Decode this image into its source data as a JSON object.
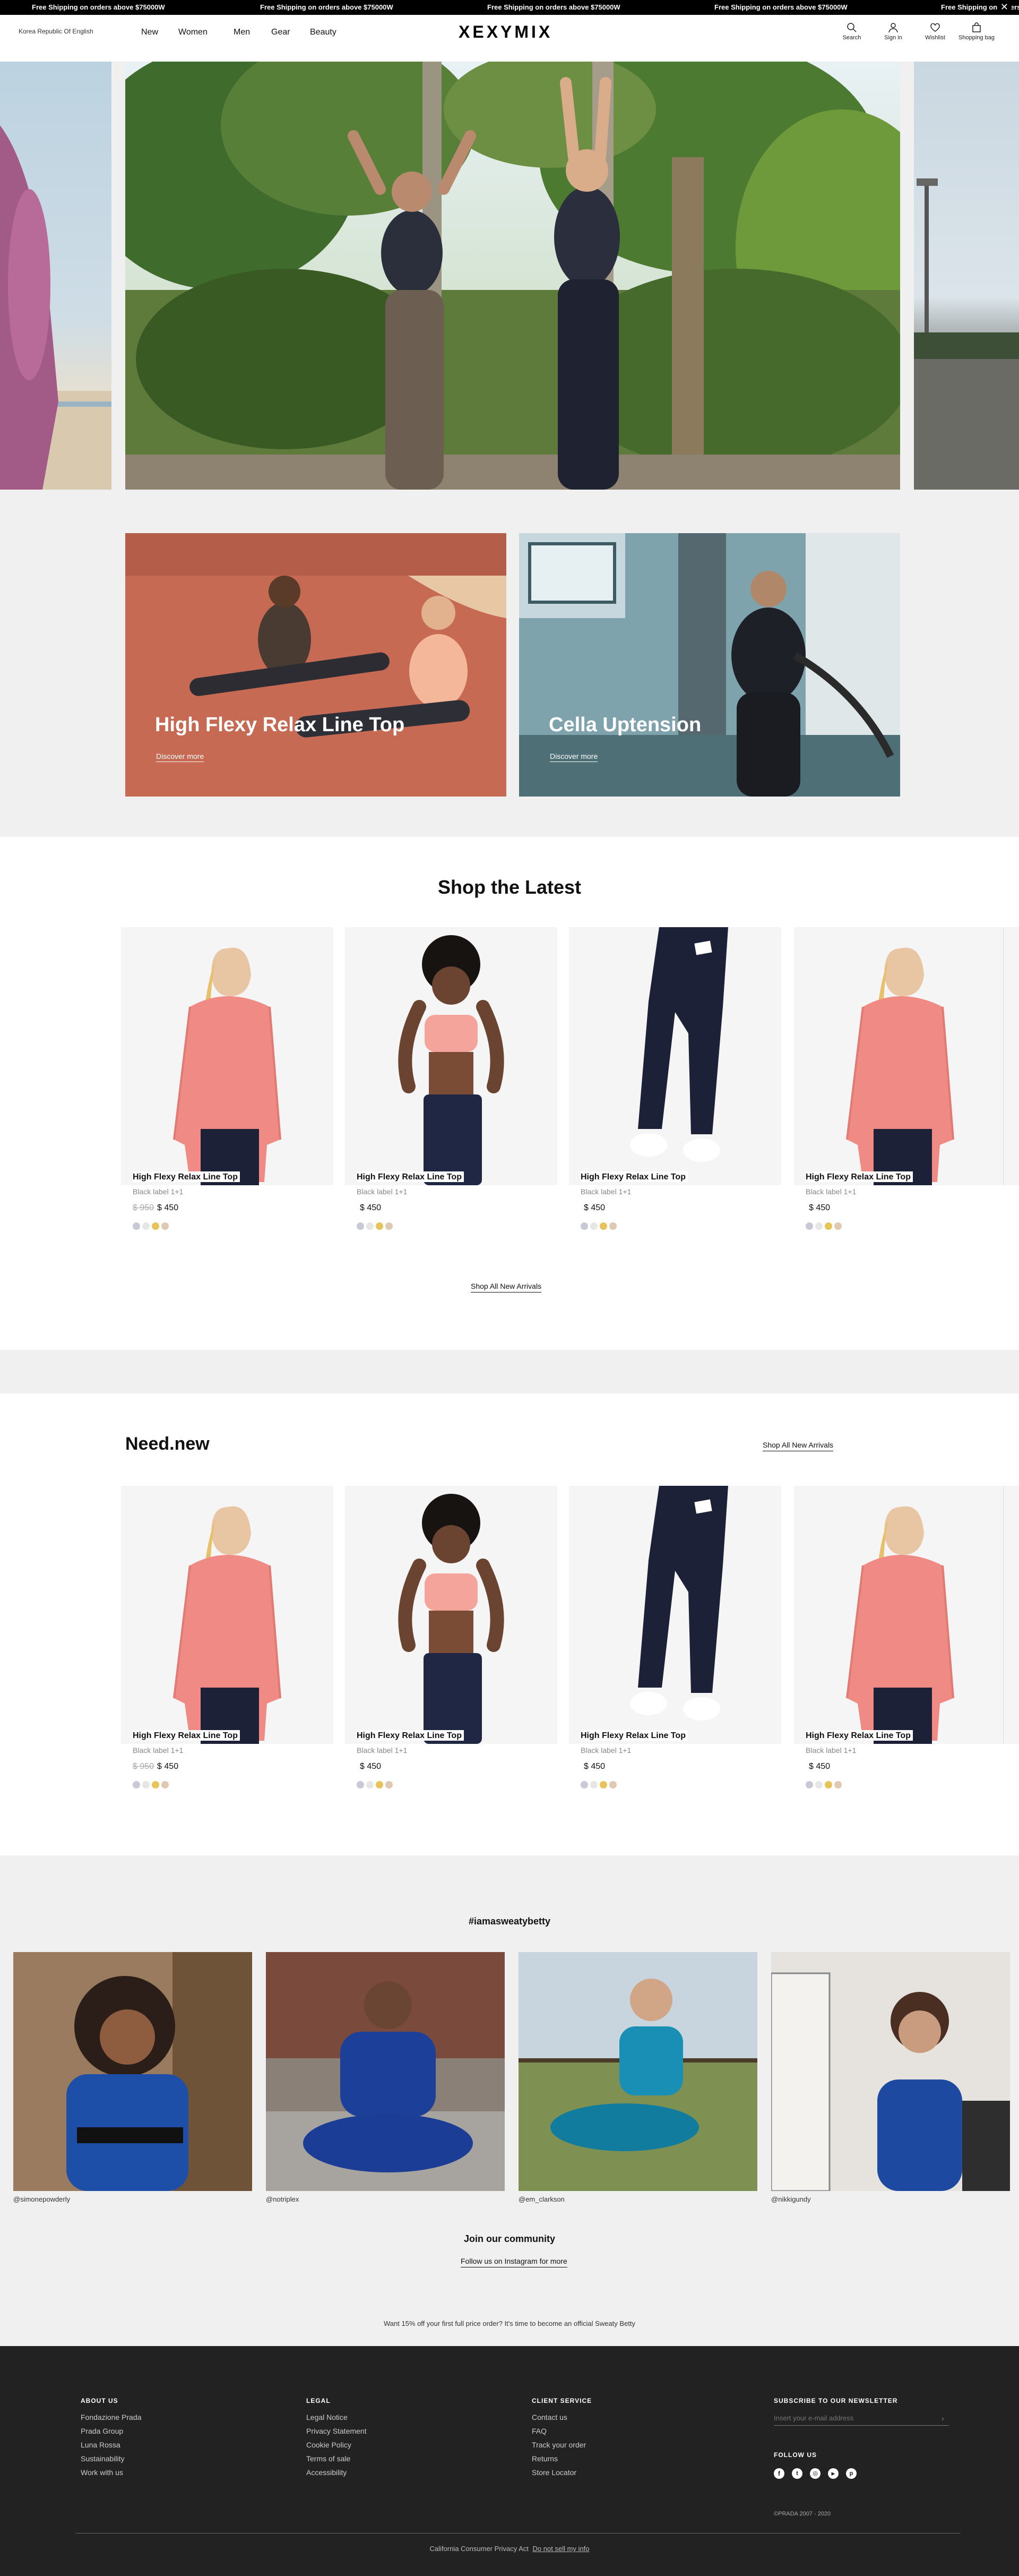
{
  "ticker": {
    "message": "Free Shipping on orders above $75000W",
    "close_label": "✕"
  },
  "header": {
    "locale": "Korea Republic Of  English",
    "nav": [
      "New",
      "Women",
      "Men",
      "Gear",
      "Beauty"
    ],
    "logo": "XEXYMIX",
    "utils": {
      "search": "Search",
      "signin": "Sign in",
      "wishlist": "Wishlist",
      "bag": "Shopping bag"
    }
  },
  "tiles": [
    {
      "title": "High Flexy Relax Line Top",
      "cta": "Discover more"
    },
    {
      "title": "Cella Uptension",
      "cta": "Discover more"
    }
  ],
  "latest": {
    "title": "Shop the Latest",
    "cta": "Shop All New Arrivals",
    "products": [
      {
        "name": "High Flexy Relax Line Top",
        "label": "Black label 1+1",
        "old_price": "$ 950",
        "price": "$ 450"
      },
      {
        "name": "High Flexy Relax Line Top",
        "label": "Black label 1+1",
        "old_price": "",
        "price": "$ 450"
      },
      {
        "name": "High Flexy Relax Line Top",
        "label": "Black label 1+1",
        "old_price": "",
        "price": "$ 450"
      },
      {
        "name": "High Flexy Relax Line Top",
        "label": "Black label 1+1",
        "old_price": "",
        "price": "$ 450"
      }
    ]
  },
  "need": {
    "title": "Need.new",
    "cta": "Shop All New Arrivals",
    "products": [
      {
        "name": "High Flexy Relax Line Top",
        "label": "Black label 1+1",
        "old_price": "$ 950",
        "price": "$ 450"
      },
      {
        "name": "High Flexy Relax Line Top",
        "label": "Black label 1+1",
        "old_price": "",
        "price": "$ 450"
      },
      {
        "name": "High Flexy Relax Line Top",
        "label": "Black label 1+1",
        "old_price": "",
        "price": "$ 450"
      },
      {
        "name": "High Flexy Relax Line Top",
        "label": "Black label 1+1",
        "old_price": "",
        "price": "$ 450"
      }
    ]
  },
  "community": {
    "hashtag": "#iamasweatybetty",
    "handles": [
      "@simonepowderly",
      "@notriplex",
      "@em_clarkson",
      "@nikkigundy"
    ],
    "title": "Join our community",
    "cta": "Follow us on Instagram for more",
    "promo": "Want 15% off your first full price order? It's time to become an official Sweaty Betty"
  },
  "footer": {
    "about": {
      "title": "ABOUT US",
      "items": [
        "Fondazione Prada",
        "Prada Group",
        "Luna Rossa",
        "Sustainability",
        "Work with us"
      ]
    },
    "legal": {
      "title": "LEGAL",
      "items": [
        "Legal Notice",
        "Privacy Statement",
        "Cookie Policy",
        "Terms of sale",
        "Accessibility"
      ]
    },
    "service": {
      "title": "CLIENT SERVICE",
      "items": [
        "Contact us",
        "FAQ",
        "Track your order",
        "Returns",
        "Store Locator"
      ]
    },
    "newsletter": {
      "title": "SUBSCRIBE TO OUR NEWSLETTER",
      "placeholder": "Insert your e-mail address"
    },
    "follow": "FOLLOW US",
    "copyright": "©PRADA 2007 - 2020",
    "ccpa_text": "California Consumer Privacy Act",
    "ccpa_link": "Do not sell my info"
  },
  "colors": {
    "ticker_bg": "#000000",
    "footer_bg": "#222222",
    "section_grey": "#f0f0f0",
    "swatches": [
      "#c7cad6",
      "#e6e6e6",
      "#e8c35a",
      "#e0c9b3"
    ]
  }
}
